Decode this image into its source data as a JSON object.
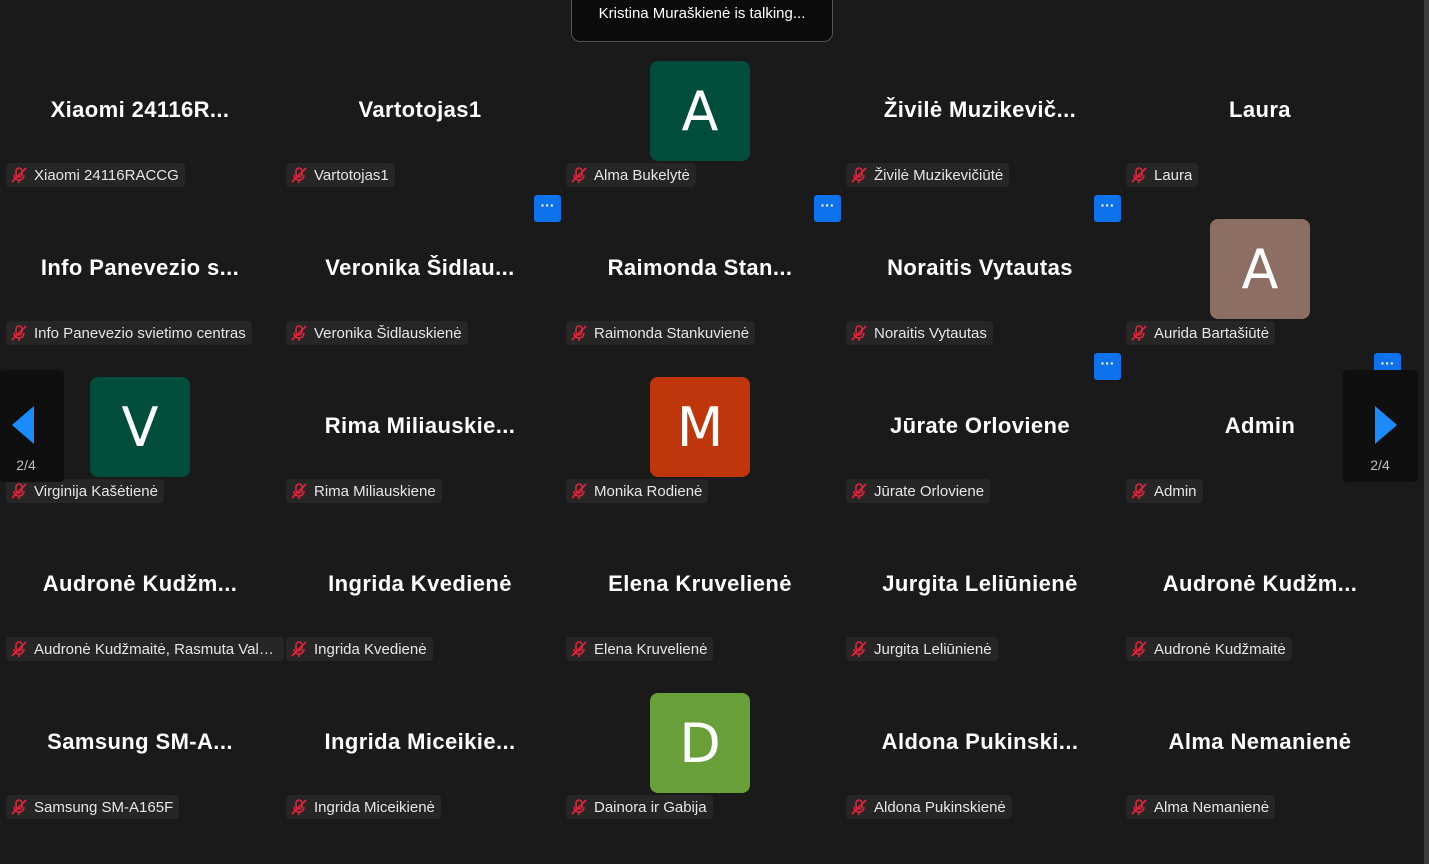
{
  "talking_banner": "Kristina Muraškienė is talking...",
  "pager": {
    "left_label": "2/4",
    "right_label": "2/4"
  },
  "colors": {
    "more_button": "#0e72ed",
    "mic_muted": "#e0243b"
  },
  "participants": [
    {
      "big": "Xiaomi  24116R...",
      "label": "Xiaomi 24116RACCG"
    },
    {
      "big": "Vartotojas1",
      "label": "Vartotojas1"
    },
    {
      "avatar": "A",
      "avatar_color": "#004d3c",
      "label": "Alma Bukelytė"
    },
    {
      "big": "Živilė  Muzikevič...",
      "label": "Živilė Muzikevičiūtė"
    },
    {
      "big": "Laura",
      "label": "Laura"
    },
    {
      "big": "Info  Panevezio  s...",
      "label": "Info Panevezio svietimo centras"
    },
    {
      "big": "Veronika  Šidlau...",
      "label": "Veronika Šidlauskienė"
    },
    {
      "big": "Raimonda  Stan...",
      "label": "Raimonda Stankuvienė"
    },
    {
      "big": "Noraitis Vytautas",
      "label": "Noraitis Vytautas"
    },
    {
      "avatar": "A",
      "avatar_color": "#8d6e63",
      "label": "Aurida Bartašiūtė"
    },
    {
      "avatar": "V",
      "avatar_color": "#004d3c",
      "label": "Virginija Kašėtienė"
    },
    {
      "big": "Rima  Miliauskie...",
      "label": "Rima Miliauskiene"
    },
    {
      "avatar": "M",
      "avatar_color": "#bf360c",
      "label": "Monika Rodienė"
    },
    {
      "big": "Jūrate Orloviene",
      "label": "Jūrate Orloviene"
    },
    {
      "big": "Admin",
      "label": "Admin"
    },
    {
      "big": "Audronė  Kudžm...",
      "label": "Audronė Kudžmaitė, Rasmuta Valčiukienė"
    },
    {
      "big": "Ingrida Kvedienė",
      "label": "Ingrida Kvedienė"
    },
    {
      "big": "Elena Kruvelienė",
      "label": "Elena Kruvelienė"
    },
    {
      "big": "Jurgita Leliūnienė",
      "label": "Jurgita Leliūnienė"
    },
    {
      "big": "Audronė  Kudžm...",
      "label": "Audronė Kudžmaitė"
    },
    {
      "big": "Samsung  SM-A...",
      "label": "Samsung SM-A165F"
    },
    {
      "big": "Ingrida  Miceikie...",
      "label": "Ingrida Miceikienė"
    },
    {
      "avatar": "D",
      "avatar_color": "#689f38",
      "label": "Dainora ir Gabija"
    },
    {
      "big": "Aldona  Pukinski...",
      "label": "Aldona Pukinskienė"
    },
    {
      "big": "Alma Nemanienė",
      "label": "Alma Nemanienė"
    }
  ],
  "more_buttons": [
    {
      "label": "···"
    },
    {
      "label": "···"
    },
    {
      "label": "···"
    },
    {
      "label": "···"
    },
    {
      "label": "···"
    }
  ]
}
